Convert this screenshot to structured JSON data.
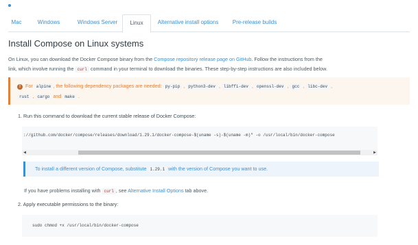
{
  "tabs": [
    {
      "label": "Mac"
    },
    {
      "label": "Windows"
    },
    {
      "label": "Windows Server"
    },
    {
      "label": "Linux"
    },
    {
      "label": "Alternative install options"
    },
    {
      "label": "Pre-release builds"
    }
  ],
  "active_tab": "Linux",
  "heading": "Install Compose on Linux systems",
  "intro": {
    "line1_prefix": "On Linux, you can download the Docker Compose binary from the ",
    "line1_link": "Compose repository release page on GitHub",
    "line1_suffix": ". Follow the instructions from the",
    "line2_prefix": "link, which involve running the ",
    "line2_code": "curl",
    "line2_suffix": " command in your terminal to download the binaries. These step-by-step instructions are also included below."
  },
  "warning": {
    "prefix": "For ",
    "alpine": "alpine",
    "middle": ", the following dependency packages are needed: ",
    "pkg1": "py-pip",
    "pkg2": "python3-dev",
    "pkg3": "libffi-dev",
    "pkg4": "openssl-dev",
    "pkg5": "gcc",
    "pkg6": "libc-dev",
    "pkg7": "rust",
    "pkg8": "cargo",
    "and": "and",
    "pkg9": "make",
    "sep": ",",
    "end": "."
  },
  "step1": {
    "text": "1. Run this command to download the current stable release of Docker Compose:",
    "command": "://github.com/docker/compose/releases/download/1.29.1/docker-compose-$(uname -s)-$(uname -m)\" -o /usr/local/bin/docker-compose"
  },
  "note": {
    "prefix": "To install a different version of Compose, substitute ",
    "version": "1.29.1",
    "suffix": " with the version of Compose you want to use."
  },
  "problems": {
    "prefix": "If you have problems installing with ",
    "code": "curl",
    "middle": ", see ",
    "link": "Alternative Install Options",
    "suffix": " tab above."
  },
  "step2": {
    "text": "2. Apply executable permissions to the binary:",
    "command": "sudo chmod +x /usr/local/bin/docker-compose"
  }
}
